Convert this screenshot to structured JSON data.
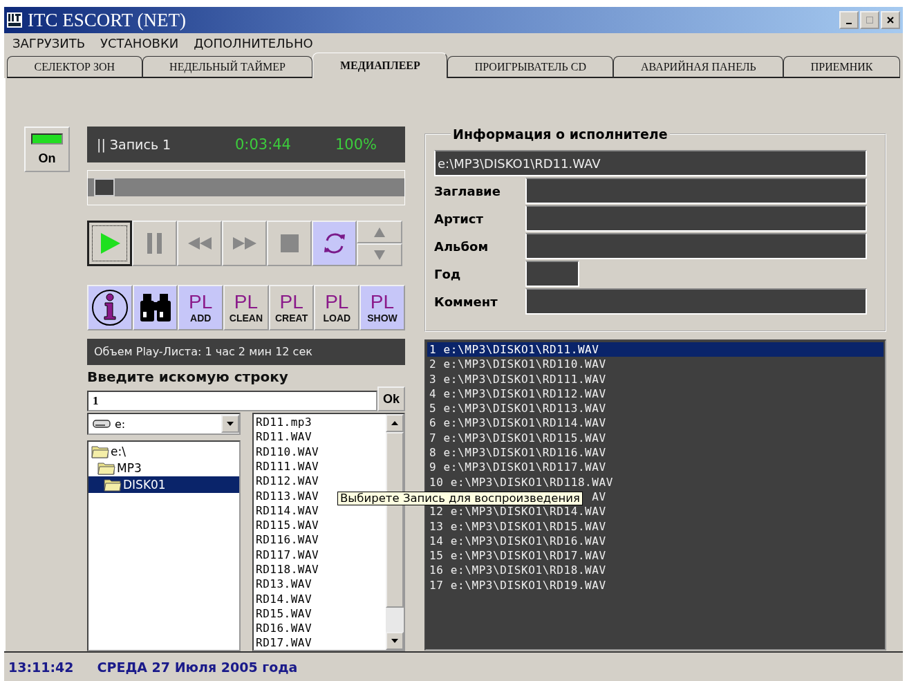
{
  "window": {
    "title": "ITC ESCORT (NET)"
  },
  "menu": [
    "ЗАГРУЗИТЬ",
    "УСТАНОВКИ",
    "ДОПОЛНИТЕЛЬНО"
  ],
  "tabs": [
    {
      "label": "СЕЛЕКТОР ЗОН",
      "selected": false
    },
    {
      "label": "НЕДЕЛЬНЫЙ ТАЙМЕР",
      "selected": false
    },
    {
      "label": "МЕДИАПЛЕЕР",
      "selected": true
    },
    {
      "label": "ПРОИГРЫВАТЕЛЬ CD",
      "selected": false
    },
    {
      "label": "АВАРИЙНАЯ ПАНЕЛЬ",
      "selected": false
    },
    {
      "label": "ПРИЕМНИК",
      "selected": false
    }
  ],
  "power": {
    "label": "On",
    "on": true
  },
  "display": {
    "status": "|| Запись 1",
    "time": "0:03:44",
    "volume": "100%"
  },
  "position_slider": {
    "level": 0.02
  },
  "transport": [
    {
      "kind": "play",
      "on": true
    },
    {
      "kind": "pause",
      "on": false
    },
    {
      "kind": "rewind",
      "on": false
    },
    {
      "kind": "forward",
      "on": false
    },
    {
      "kind": "stop",
      "on": false
    },
    {
      "kind": "repeat",
      "on": true
    }
  ],
  "playlist_buttons": [
    {
      "kind": "info",
      "highlighted": true
    },
    {
      "kind": "search",
      "highlighted": true
    },
    {
      "kind": "text",
      "top": "PL",
      "bottom": "ADD",
      "highlighted": true
    },
    {
      "kind": "text",
      "top": "PL",
      "bottom": "CLEAN",
      "highlighted": false
    },
    {
      "kind": "text",
      "top": "PL",
      "bottom": "CREAT",
      "highlighted": false
    },
    {
      "kind": "text",
      "top": "PL",
      "bottom": "LOAD",
      "highlighted": false
    },
    {
      "kind": "text",
      "top": "PL",
      "bottom": "SHOW",
      "highlighted": true
    }
  ],
  "playlist_length": "Объем Play-Листа: 1 час 2 мин 12 сек",
  "search": {
    "label": "Введите искомую строку",
    "value": "1",
    "button": "Ok"
  },
  "drive": "e:",
  "folders": [
    {
      "name": "e:\\",
      "selected": false,
      "children": [
        {
          "name": "MP3",
          "selected": false,
          "children": [
            {
              "name": "DISK01",
              "selected": true
            }
          ]
        }
      ]
    }
  ],
  "files": [
    "RD11.mp3",
    "RD11.WAV",
    "RD110.WAV",
    "RD111.WAV",
    "RD112.WAV",
    "RD113.WAV",
    "RD114.WAV",
    "RD115.WAV",
    "RD116.WAV",
    "RD117.WAV",
    "RD118.WAV",
    "RD13.WAV",
    "RD14.WAV",
    "RD15.WAV",
    "RD16.WAV",
    "RD17.WAV"
  ],
  "info": {
    "legend": "Информация о исполнителе",
    "path": "e:\\MP3\\DISKO1\\RD11.WAV",
    "fields": [
      {
        "label": "Заглавие",
        "kind": "wide"
      },
      {
        "label": "Артист",
        "kind": "wide"
      },
      {
        "label": "Альбом",
        "kind": "wide"
      },
      {
        "label": "Год",
        "kind": "short"
      },
      {
        "label": "Коммент",
        "kind": "wide"
      }
    ]
  },
  "playlist": [
    {
      "text": "1 e:\\MP3\\DISKO1\\RD11.WAV",
      "selected": true
    },
    {
      "text": "2 e:\\MP3\\DISKO1\\RD110.WAV",
      "selected": false
    },
    {
      "text": "3 e:\\MP3\\DISKO1\\RD111.WAV",
      "selected": false
    },
    {
      "text": "4 e:\\MP3\\DISKO1\\RD112.WAV",
      "selected": false
    },
    {
      "text": "5 e:\\MP3\\DISKO1\\RD113.WAV",
      "selected": false
    },
    {
      "text": "6 e:\\MP3\\DISKO1\\RD114.WAV",
      "selected": false
    },
    {
      "text": "7 e:\\MP3\\DISKO1\\RD115.WAV",
      "selected": false
    },
    {
      "text": "8 e:\\MP3\\DISKO1\\RD116.WAV",
      "selected": false
    },
    {
      "text": "9 e:\\MP3\\DISKO1\\RD117.WAV",
      "selected": false
    },
    {
      "text": "10 e:\\MP3\\DISKO1\\RD118.WAV",
      "selected": false
    },
    {
      "text": "AV",
      "selected": false,
      "covered": true
    },
    {
      "text": "12 e:\\MP3\\DISKO1\\RD14.WAV",
      "selected": false
    },
    {
      "text": "13 e:\\MP3\\DISKO1\\RD15.WAV",
      "selected": false
    },
    {
      "text": "14 e:\\MP3\\DISKO1\\RD16.WAV",
      "selected": false
    },
    {
      "text": "15 e:\\MP3\\DISKO1\\RD17.WAV",
      "selected": false
    },
    {
      "text": "16 e:\\MP3\\DISKO1\\RD18.WAV",
      "selected": false
    },
    {
      "text": "17 e:\\MP3\\DISKO1\\RD19.WAV",
      "selected": false
    }
  ],
  "tooltip": "Выбирете Запись для воспроизведения",
  "status_bar": {
    "time": "13:11:42",
    "date": "СРЕДА 27 Июля 2005 года"
  }
}
